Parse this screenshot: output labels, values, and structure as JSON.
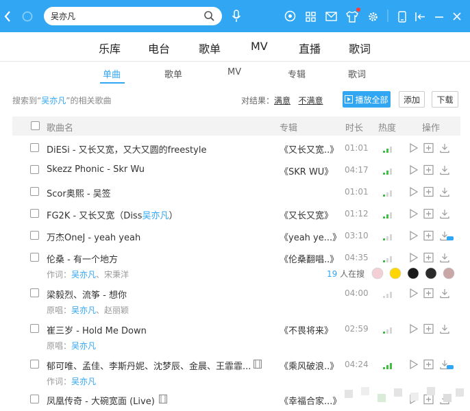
{
  "search": {
    "value": "吴亦凡"
  },
  "nav_primary": [
    "乐库",
    "电台",
    "歌单",
    "MV",
    "直播",
    "歌词"
  ],
  "nav_secondary": {
    "items": [
      "单曲",
      "歌单",
      "MV",
      "专辑",
      "歌词"
    ],
    "active": "单曲"
  },
  "result": {
    "prefix": "搜索到“",
    "keyword": "吴亦凡",
    "suffix": "”的相关歌曲"
  },
  "feedback": {
    "label": "对结果：",
    "satisfied": "满意",
    "unsatisfied": "不满意"
  },
  "buttons": {
    "play_all": "播放全部",
    "add": "添加",
    "download": "下载"
  },
  "columns": {
    "song": "歌曲名",
    "album": "专辑",
    "duration": "时长",
    "heat": "热度",
    "action": "操作"
  },
  "songs": [
    {
      "title": "DiESi - 又长又宽，又大又圆的freestyle",
      "album": "《又长又宽..》",
      "duration": "01:01",
      "heat": 2
    },
    {
      "title": "Skezz Phonic - Skr Wu",
      "album": "《SKR WU》",
      "duration": "04:17",
      "heat": 2
    },
    {
      "title": "Scor奥熙 - 吴签",
      "album": "",
      "duration": "01:01",
      "heat": 1
    },
    {
      "title_prefix": "FG2K - 又长又宽（Diss",
      "title_hl": "吴亦凡",
      "title_suffix": "）",
      "album": "《又长又宽》",
      "duration": "01:12",
      "heat": 2
    },
    {
      "title": "万杰OneJ - yeah yeah",
      "album": "《yeah ye...》",
      "duration": "03:10",
      "heat": 1
    },
    {
      "title": "伦桑 - 有一个地方",
      "album": "《伦桑翻唱..》",
      "duration": "04:35",
      "heat": 1,
      "sub_label": "作词：",
      "sub_hl": "吴亦凡",
      "sub_rest": "、宋秉洋",
      "live_count": "19",
      "live_text": " 人在搜"
    },
    {
      "title": "梁毅烈、流筝 - 想你",
      "album": "",
      "duration": "04:00",
      "heat": 0,
      "sub_label": "原唱：",
      "sub_hl": "吴亦凡",
      "sub_rest": "、赵丽颖"
    },
    {
      "title": "崔三岁 - Hold Me Down",
      "album": "《不畏将来》",
      "duration": "02:59",
      "heat": 1,
      "sub_label": "原唱：",
      "sub_hl": "吴亦凡",
      "sub_rest": ""
    },
    {
      "title": "郁可唯、孟佳、李斯丹妮、沈梦辰、金晨、王霏霏...",
      "album": "《乘风破浪..》",
      "duration": "04:24",
      "heat": 3,
      "sub_label": "作词：",
      "sub_hl": "吴亦凡",
      "sub_rest": ""
    },
    {
      "title": "凤凰传奇 - 大碗宽面 (Live)",
      "album": "《幸福合家...》",
      "duration": "",
      "heat": 0
    }
  ],
  "colors": {
    "accent": "#31a6f2",
    "heat_active": "#3fbf3f"
  }
}
